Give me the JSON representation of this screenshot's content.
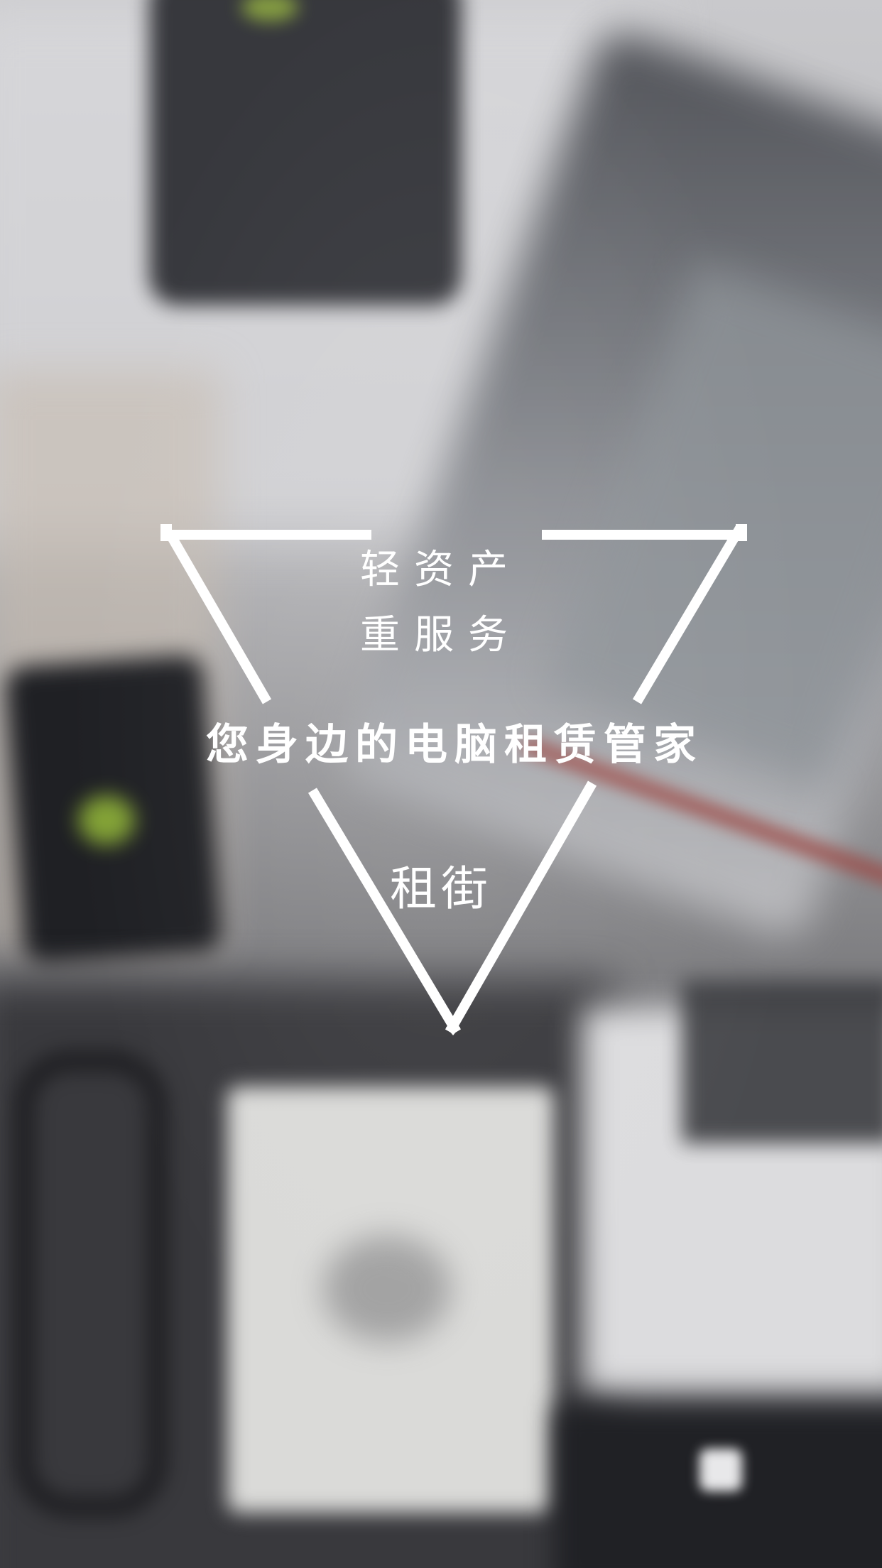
{
  "splash": {
    "tagline_line1": "轻资产",
    "tagline_line2": "重服务",
    "headline": "您身边的电脑租赁管家",
    "brand_name": "租街"
  },
  "colors": {
    "text": "#ffffff",
    "triangle_stroke": "#ffffff"
  }
}
